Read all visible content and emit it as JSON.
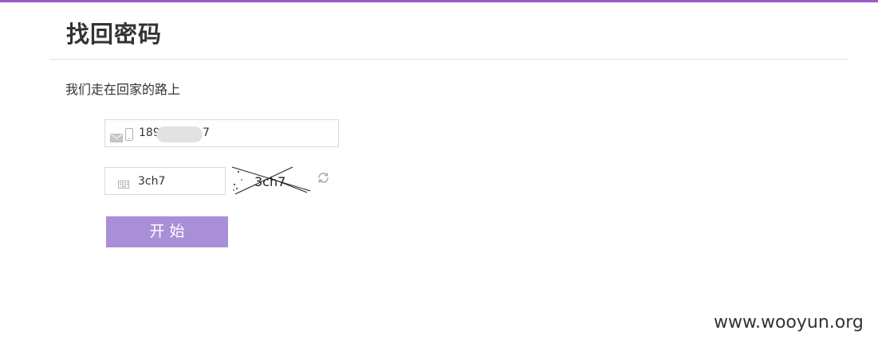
{
  "page": {
    "title": "找回密码",
    "subtitle": "我们走在回家的路上"
  },
  "form": {
    "phone": {
      "value_prefix": "189",
      "value_suffix": "7",
      "icons": [
        "mail-icon",
        "mobile-icon"
      ]
    },
    "captcha": {
      "value": "3ch7",
      "image_text": "3ch7",
      "icon": "keyboard-icon",
      "refresh_icon": "refresh-icon"
    },
    "start_button_label": "开始"
  },
  "watermark": "www.wooyun.org",
  "colors": {
    "accent_bar": "#9a5bc6",
    "button_bg": "#a98ed8",
    "border": "#d9d9d9"
  }
}
